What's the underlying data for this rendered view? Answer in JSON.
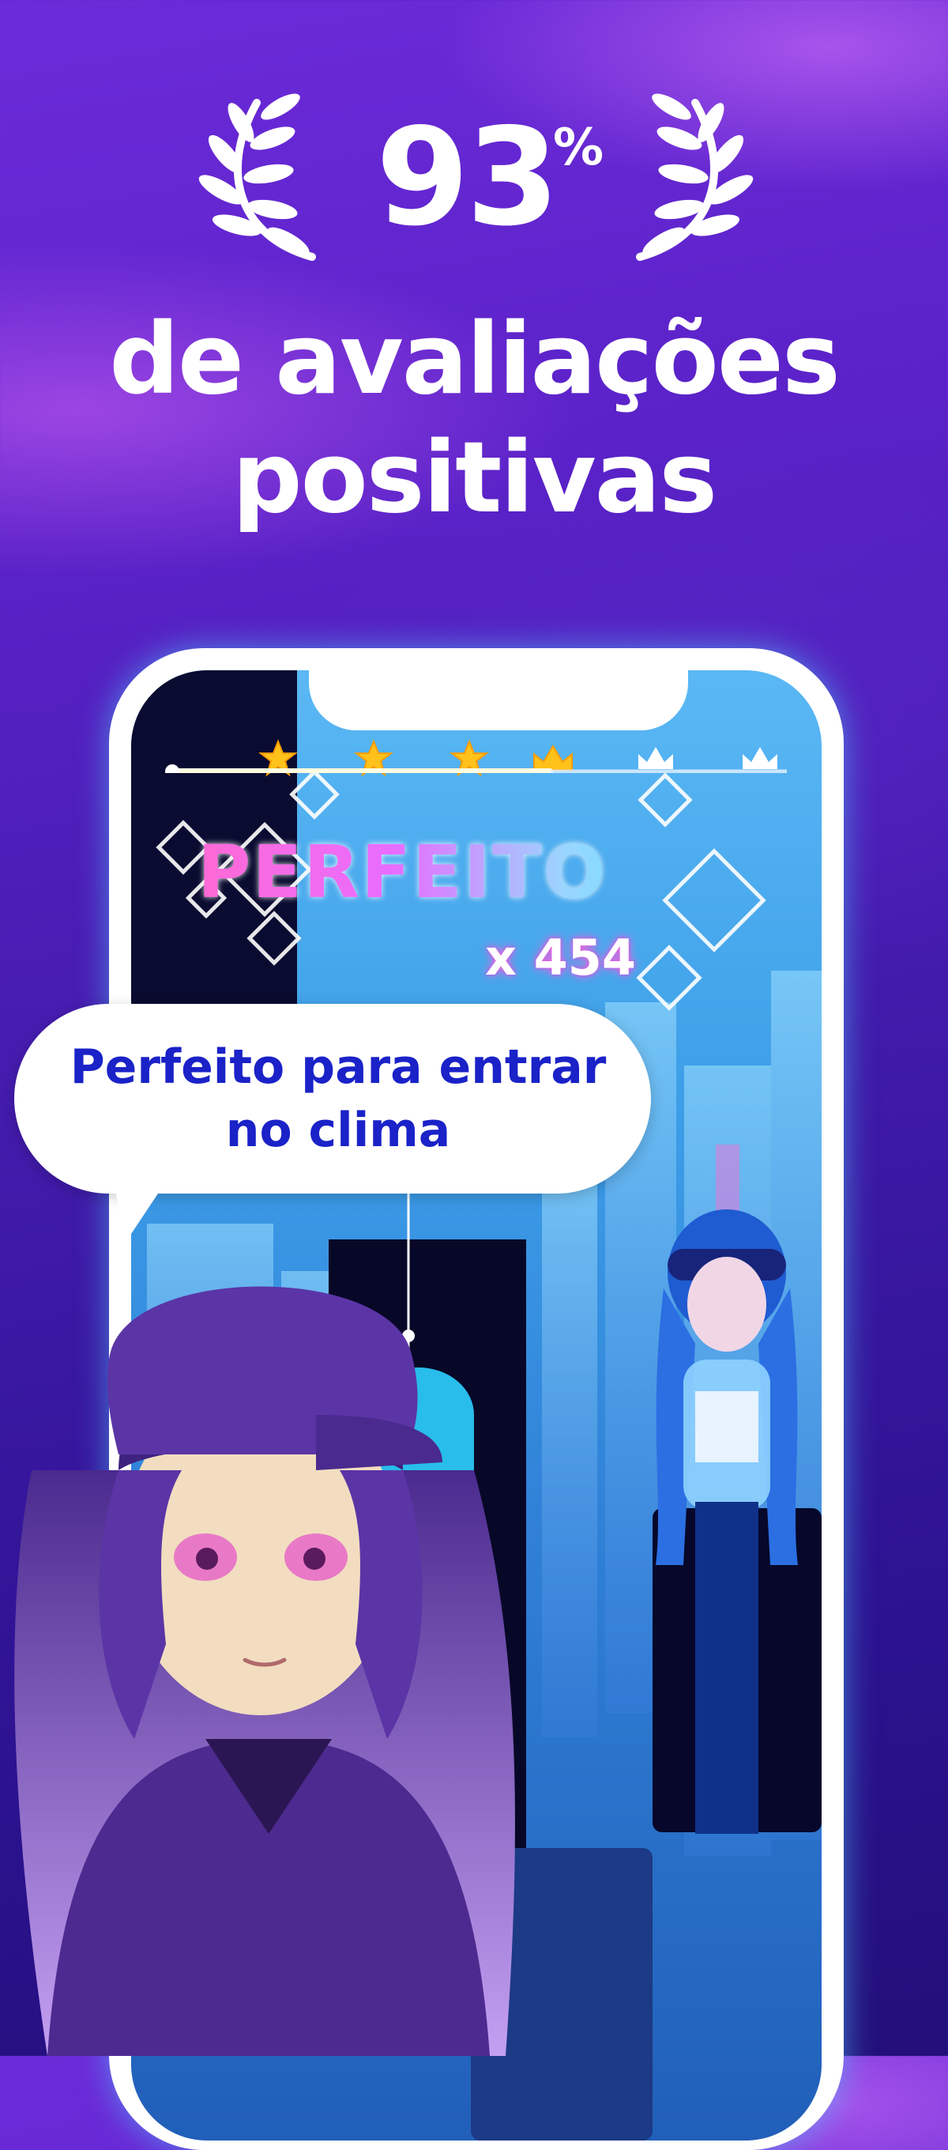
{
  "hero": {
    "score_value": "93",
    "score_unit": "%",
    "headline_line1": "de avaliações",
    "headline_line2": "positivas"
  },
  "game": {
    "progress_stars_filled": 3,
    "progress_crown_reached": 1,
    "progress_crowns_total": 3,
    "rating_label": "PERFEITO",
    "combo_label": "x 454"
  },
  "speech_bubble": {
    "line1": "Perfeito para entrar",
    "line2": "no clima"
  },
  "colors": {
    "background_purple": "#5a22c8",
    "screen_blue": "#3d9ee8",
    "dark_tile": "#070827",
    "bubble_text": "#1a22c8",
    "star_gold": "#ffc21a"
  }
}
